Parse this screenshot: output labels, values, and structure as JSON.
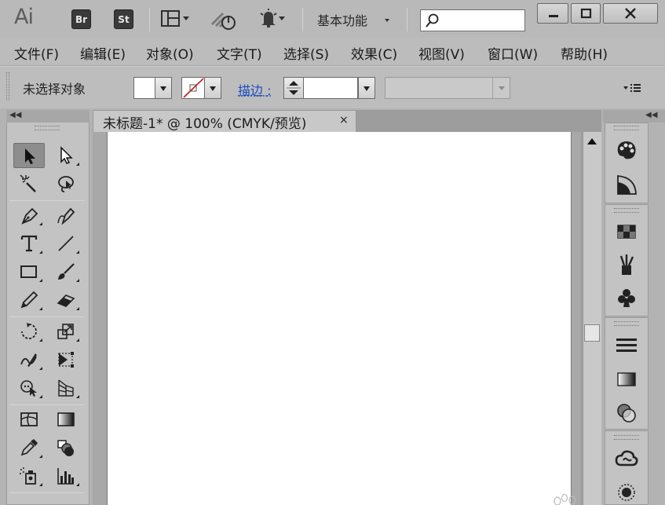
{
  "app": {
    "logo": "Ai",
    "bridge_button": "Br",
    "stock_button": "St",
    "workspace": "基本功能",
    "search": {
      "value": "",
      "placeholder": ""
    }
  },
  "menu": [
    "文件(F)",
    "编辑(E)",
    "对象(O)",
    "文字(T)",
    "选择(S)",
    "效果(C)",
    "视图(V)",
    "窗口(W)",
    "帮助(H)"
  ],
  "control_bar": {
    "selection_status": "未选择对象",
    "stroke_label": "描边",
    "stroke_colon": ":",
    "stroke_weight": ""
  },
  "document": {
    "tab_title": "未标题-1* @ 100% (CMYK/预览)",
    "close_glyph": "×"
  },
  "colors": {
    "accent_link": "#1b4dc2",
    "panel_bg": "#c3c3c3",
    "artboard": "#ffffff"
  },
  "tools": [
    "selection-tool",
    "direct-selection-tool",
    "magic-wand-tool",
    "lasso-tool",
    "pen-tool",
    "curvature-tool",
    "type-tool",
    "line-segment-tool",
    "rectangle-tool",
    "paintbrush-tool",
    "pencil-tool",
    "eraser-tool",
    "rotate-tool",
    "scale-tool",
    "warp-tool",
    "free-transform-tool",
    "shape-builder-tool",
    "perspective-grid-tool",
    "mesh-tool",
    "gradient-tool",
    "eyedropper-tool",
    "blend-tool",
    "symbol-sprayer-tool",
    "column-graph-tool"
  ],
  "right_panels": [
    "color-panel-icon",
    "color-guide-panel-icon",
    "swatches-panel-icon",
    "brushes-panel-icon",
    "symbols-panel-icon",
    "stroke-panel-icon",
    "gradient-panel-icon",
    "transparency-panel-icon",
    "cc-libraries-panel-icon",
    "appearance-panel-icon"
  ]
}
